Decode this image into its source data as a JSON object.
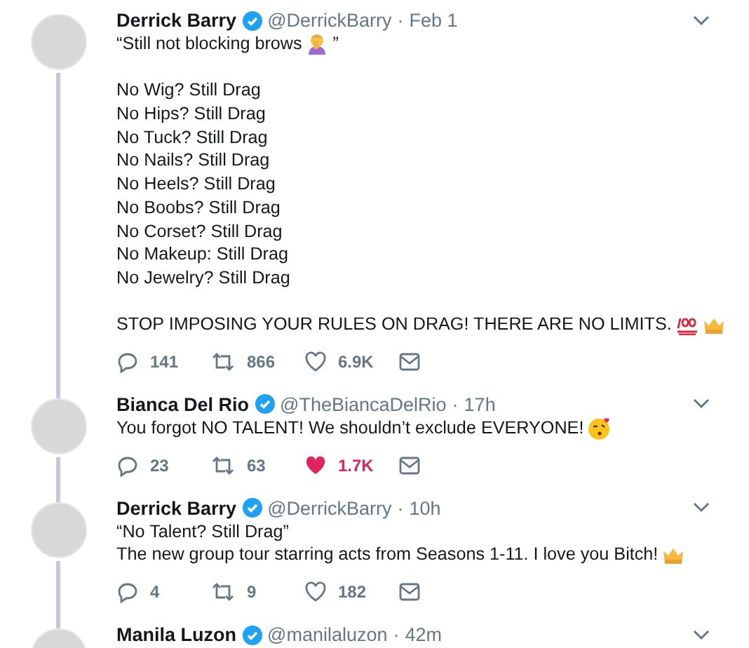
{
  "tweets": [
    {
      "name": "Derrick Barry",
      "verified": true,
      "handle": "@DerrickBarry",
      "separator": "·",
      "time": "Feb 1",
      "thread_line": true,
      "liked": false,
      "paragraphs": [
        [
          [
            {
              "text": "“Still not blocking brows"
            },
            {
              "kind": "facepalm"
            },
            {
              "text": "”"
            }
          ]
        ],
        [
          [
            {
              "text": "No Wig? Still Drag"
            }
          ],
          [
            {
              "text": "No Hips? Still Drag"
            }
          ],
          [
            {
              "text": "No Tuck? Still Drag"
            }
          ],
          [
            {
              "text": "No Nails? Still Drag"
            }
          ],
          [
            {
              "text": "No Heels? Still Drag"
            }
          ],
          [
            {
              "text": "No Boobs? Still Drag"
            }
          ],
          [
            {
              "text": "No Corset? Still Drag"
            }
          ],
          [
            {
              "text": "No Makeup: Still Drag"
            }
          ],
          [
            {
              "text": "No Jewelry? Still Drag"
            }
          ]
        ],
        [
          [
            {
              "text": "STOP IMPOSING YOUR RULES ON DRAG! THERE ARE NO LIMITS."
            },
            {
              "kind": "hundred"
            },
            {
              "kind": "crown"
            }
          ]
        ]
      ],
      "replies": "141",
      "retweets": "866",
      "likes": "6.9K"
    },
    {
      "name": "Bianca Del Rio",
      "verified": true,
      "handle": "@TheBiancaDelRio",
      "separator": "·",
      "time": "17h",
      "thread_line": true,
      "liked": true,
      "paragraphs": [
        [
          [
            {
              "text": "You forgot NO TALENT! We shouldn’t exclude EVERYONE!"
            },
            {
              "kind": "kiss"
            }
          ]
        ]
      ],
      "replies": "23",
      "retweets": "63",
      "likes": "1.7K"
    },
    {
      "name": "Derrick Barry",
      "verified": true,
      "handle": "@DerrickBarry",
      "separator": "·",
      "time": "10h",
      "thread_line": true,
      "liked": false,
      "paragraphs": [
        [
          [
            {
              "text": "“No Talent? Still Drag”"
            }
          ],
          [
            {
              "text": "The new group tour starring acts from Seasons 1-11. I love you Bitch!"
            },
            {
              "kind": "crown"
            }
          ]
        ]
      ],
      "replies": "4",
      "retweets": "9",
      "likes": "182"
    },
    {
      "name": "Manila Luzon",
      "verified": true,
      "handle": "@manilaluzon",
      "separator": "·",
      "time": "42m"
    }
  ]
}
